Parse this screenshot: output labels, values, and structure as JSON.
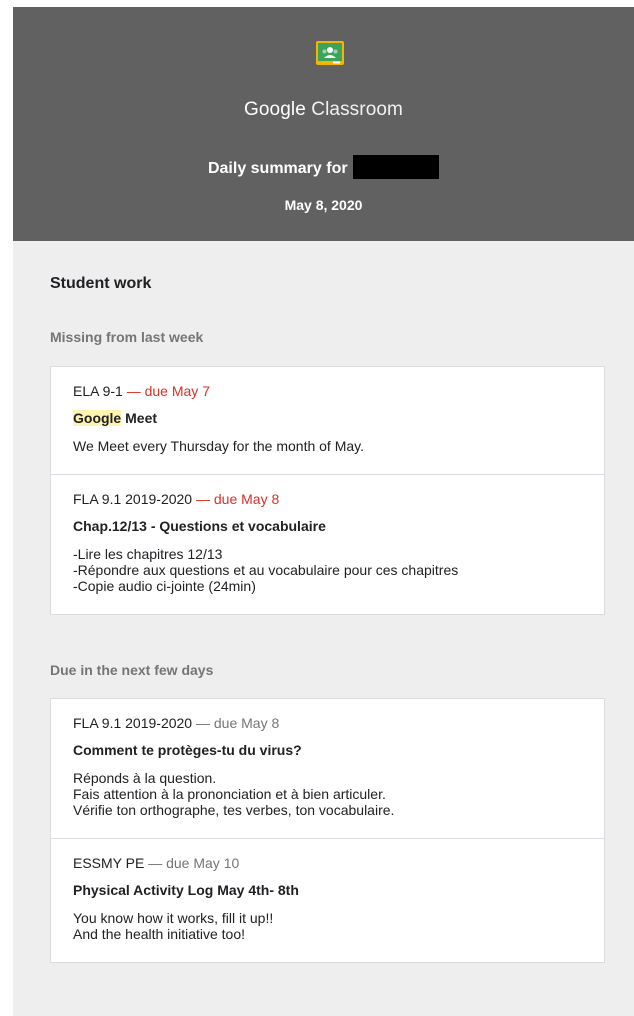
{
  "header": {
    "brand_first": "Google",
    "brand_second": " Classroom",
    "summary_title": "Daily summary for",
    "date": "May 8, 2020",
    "logo_icon": "google-classroom-logo-icon",
    "colors": {
      "header_bg": "#616161",
      "logo_green": "#3ca45a",
      "logo_border": "#f5b400"
    }
  },
  "main": {
    "section_title": "Student work",
    "missing_title": "Missing from last week",
    "upcoming_title": "Due in the next few days",
    "missing": [
      {
        "class_name": "ELA 9-1",
        "due": "— due May 7",
        "title_highlight": "Google",
        "title": " Meet",
        "body": [
          "We Meet every Thursday for the month of May."
        ]
      },
      {
        "class_name": "FLA 9.1 2019-2020",
        "due": "— due May 8",
        "title_highlight": "",
        "title": "Chap.12/13 - Questions et vocabulaire",
        "body": [
          "-Lire les chapitres 12/13",
          "-Répondre aux questions et au vocabulaire pour ces chapitres",
          "-Copie audio ci-jointe (24min)"
        ]
      }
    ],
    "upcoming": [
      {
        "class_name": "FLA 9.1 2019-2020",
        "due": "— due May 8",
        "title": "Comment te protèges-tu du virus?",
        "body": [
          "Réponds à la question.",
          "Fais attention à la prononciation et à bien articuler.",
          "Vérifie ton orthographe, tes verbes, ton vocabulaire."
        ]
      },
      {
        "class_name": "ESSMY PE",
        "due": "— due May 10",
        "title": "Physical Activity Log May 4th- 8th",
        "body": [
          "You know how it works, fill it up!!",
          "And the health initiative too!"
        ]
      }
    ],
    "colors": {
      "due_missing": "#d93025",
      "due_upcoming": "#757575",
      "highlight": "#fff3b0"
    }
  }
}
